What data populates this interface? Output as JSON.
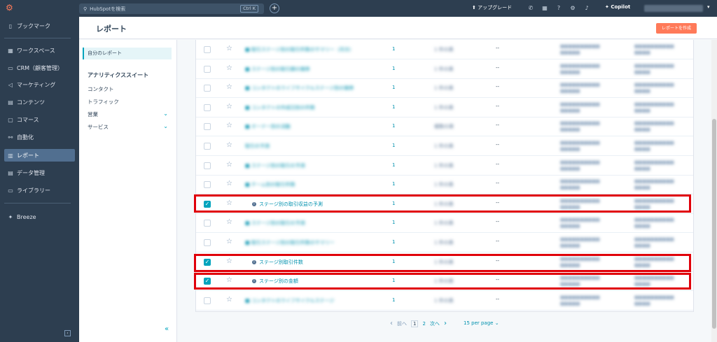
{
  "topbar": {
    "logo": "hubspot-logo",
    "search_placeholder": "HubSpotを検索",
    "search_shortcut": "Ctrl K",
    "add_label": "+",
    "upgrade_label": "アップグレード",
    "copilot_label": "Copilot"
  },
  "sidebar": {
    "items": [
      {
        "label": "ブックマーク",
        "icon": "bookmark-icon"
      },
      {
        "label": "ワークスペース",
        "icon": "workspace-icon"
      },
      {
        "label": "CRM（顧客管理）",
        "icon": "crm-icon"
      },
      {
        "label": "マーケティング",
        "icon": "marketing-icon"
      },
      {
        "label": "コンテンツ",
        "icon": "content-icon"
      },
      {
        "label": "コマース",
        "icon": "commerce-icon"
      },
      {
        "label": "自動化",
        "icon": "automation-icon"
      },
      {
        "label": "レポート",
        "icon": "reports-icon",
        "active": true
      },
      {
        "label": "データ管理",
        "icon": "data-icon"
      },
      {
        "label": "ライブラリー",
        "icon": "library-icon"
      },
      {
        "label": "Breeze",
        "icon": "breeze-icon"
      }
    ]
  },
  "header": {
    "title": "レポート",
    "create_button": "レポートを作成"
  },
  "left_panel": {
    "my_reports": "自分のレポート",
    "section_title": "アナリティクススイート",
    "items": [
      {
        "label": "コンタクト",
        "chevron": false
      },
      {
        "label": "トラフィック",
        "chevron": false
      },
      {
        "label": "営業",
        "chevron": true
      },
      {
        "label": "サービス",
        "chevron": true
      }
    ]
  },
  "table": {
    "rows": [
      {
        "checked": false,
        "name": "■ 取引ステージ別の取引件数のサマリー（月次）",
        "blur": true,
        "count": "1",
        "type": "1 件の表",
        "dash": "--"
      },
      {
        "checked": false,
        "name": "■ ステージ別の取引額の推移",
        "blur": true,
        "count": "1",
        "type": "1 件の表",
        "dash": "--"
      },
      {
        "checked": false,
        "name": "■ コンタクトのライフサイクルステージ別の推移",
        "blur": true,
        "count": "1",
        "type": "1 件の表",
        "dash": "--"
      },
      {
        "checked": false,
        "name": "■ コンタクトの作成日別の件数",
        "blur": true,
        "count": "1",
        "type": "1 件の表",
        "dash": "--"
      },
      {
        "checked": false,
        "name": "■ オーナー別の活動",
        "blur": true,
        "count": "1",
        "type": "複数の表",
        "dash": "--"
      },
      {
        "checked": false,
        "name": "取引の予測",
        "blur": true,
        "count": "1",
        "type": "1 件の表",
        "dash": "--"
      },
      {
        "checked": false,
        "name": "■ ステージ別の取引の予測",
        "blur": true,
        "count": "1",
        "type": "1 件の表",
        "dash": "--"
      },
      {
        "checked": false,
        "name": "■ チーム別の取引件数",
        "blur": true,
        "count": "1",
        "type": "1 件の表",
        "dash": "--"
      },
      {
        "checked": true,
        "name": "ステージ別の取引収益の予測",
        "blur": false,
        "count": "1",
        "type": "1 件の表",
        "dash": "--"
      },
      {
        "checked": false,
        "name": "■ ステージ別の取引の予測",
        "blur": true,
        "count": "1",
        "type": "1 件の表",
        "dash": "--"
      },
      {
        "checked": false,
        "name": "■ 取引ステージ別の取引件数のサマリー",
        "blur": true,
        "count": "1",
        "type": "1 件の表",
        "dash": "--"
      },
      {
        "checked": true,
        "name": "ステージ別取引件数",
        "blur": false,
        "count": "1",
        "type": "1 件の表",
        "dash": "--"
      },
      {
        "checked": true,
        "name": "ステージ別の金額",
        "blur": false,
        "count": "1",
        "type": "1 件の表",
        "dash": "--"
      },
      {
        "checked": false,
        "name": "■ コンタクトのライフサイクルステージ",
        "blur": true,
        "count": "1",
        "type": "1 件の表",
        "dash": "--"
      }
    ]
  },
  "pagination": {
    "prev": "前へ",
    "pages": [
      "1",
      "2"
    ],
    "current": "1",
    "next": "次へ",
    "per_page": "15 per page"
  },
  "colors": {
    "sidebar_bg": "#2d3e50",
    "accent": "#00a4bd",
    "cta": "#ff7a59",
    "highlight": "#e0000a"
  }
}
